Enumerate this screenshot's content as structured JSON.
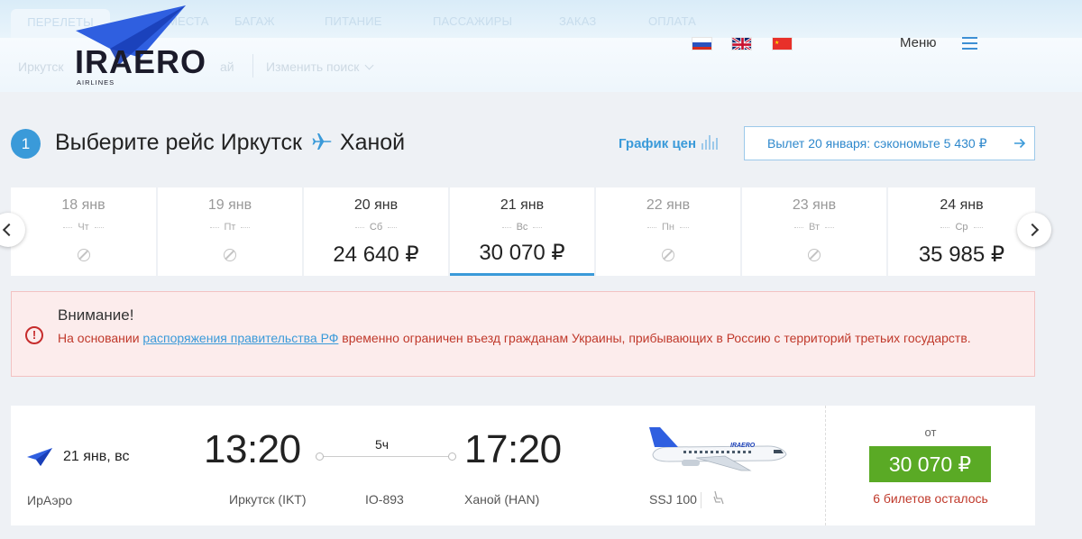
{
  "header": {
    "tabs": [
      "ПЕРЕЛЕТЫ",
      "МЕСТА",
      "БАГАЖ",
      "ПИТАНИЕ",
      "ПАССАЖИРЫ",
      "ЗАКАЗ",
      "ОПЛАТА"
    ],
    "route_short": "Иркутск",
    "route_tail": "ай",
    "change_search": "Изменить поиск",
    "logo_text": "IRAERO",
    "logo_sub": "AIRLINES",
    "languages": [
      "ru-flag",
      "uk-flag",
      "cn-flag"
    ],
    "menu_label": "Меню"
  },
  "step": {
    "number": "1",
    "title_prefix": "Выберите рейс Иркутск",
    "title_dest": "Ханой",
    "price_graph": "График цен",
    "depart_suggestion": "Вылет 20 января: сэкономьте 5 430 ₽"
  },
  "dates": [
    {
      "date": "18 янв",
      "weekday": "Чт",
      "price": null
    },
    {
      "date": "19 янв",
      "weekday": "Пт",
      "price": null
    },
    {
      "date": "20 янв",
      "weekday": "Сб",
      "price": "24 640 ₽"
    },
    {
      "date": "21 янв",
      "weekday": "Вс",
      "price": "30 070 ₽",
      "selected": true
    },
    {
      "date": "22 янв",
      "weekday": "Пн",
      "price": null
    },
    {
      "date": "23 янв",
      "weekday": "Вт",
      "price": null
    },
    {
      "date": "24 янв",
      "weekday": "Ср",
      "price": "35 985 ₽"
    }
  ],
  "alert": {
    "title": "Внимание!",
    "text_before": "На основании ",
    "link": "распоряжения правительства РФ",
    "text_after": " временно ограничен въезд гражданам Украины, прибывающих в Россию с территорий третьих государств."
  },
  "flight": {
    "date": "21 янв, вс",
    "airline": "ИрАэро",
    "depart_time": "13:20",
    "arrive_time": "17:20",
    "duration": "5ч",
    "from_airport": "Иркутск (IKT)",
    "flight_number": "IO-893",
    "to_airport": "Ханой (HAN)",
    "aircraft": "SSJ 100",
    "aircraft_livery": "IRAERO",
    "price_from": "от",
    "price": "30 070 ₽",
    "tickets_left": "6 билетов осталось"
  },
  "colors": {
    "accent": "#3a9ad9",
    "price_button": "#5aaa25",
    "alert_text": "#c0392b"
  }
}
